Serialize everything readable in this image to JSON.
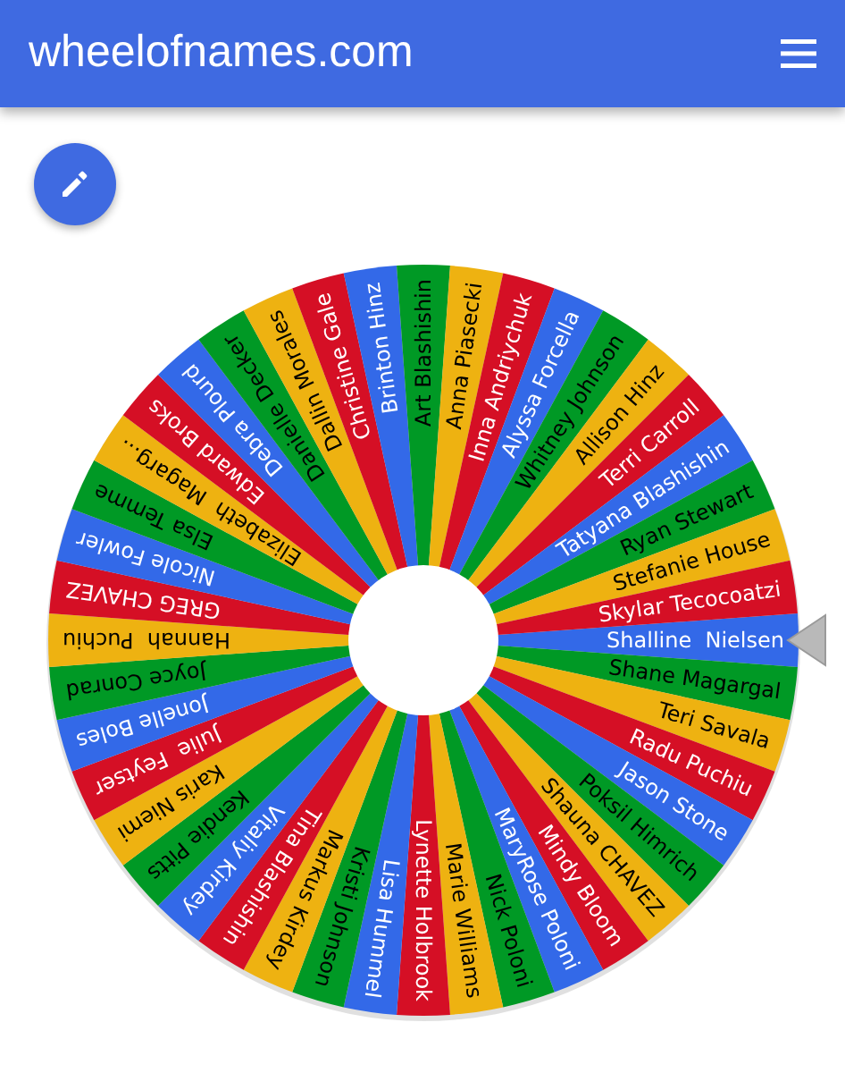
{
  "header": {
    "title": "wheelofnames.com"
  },
  "wheel": {
    "entries": [
      {
        "name": "Shalline  Nielsen"
      },
      {
        "name": "Shane Magargal"
      },
      {
        "name": "Teri Savala"
      },
      {
        "name": "Radu Puchiu"
      },
      {
        "name": "Jason Stone"
      },
      {
        "name": "Poksil Himrich"
      },
      {
        "name": "Shauna CHAVEZ"
      },
      {
        "name": "Mindy Bloom"
      },
      {
        "name": "MaryRose Poloni"
      },
      {
        "name": "Nick Poloni"
      },
      {
        "name": "Marie Williams"
      },
      {
        "name": "Lynette Holbrook"
      },
      {
        "name": "Lisa Hummel"
      },
      {
        "name": "Kristi Johnson"
      },
      {
        "name": "Markus Kirdey"
      },
      {
        "name": "Tina Blashishin"
      },
      {
        "name": "Vitaliy Kirdey"
      },
      {
        "name": "Kendie Pitts"
      },
      {
        "name": "Karis Niemi"
      },
      {
        "name": "Julie  Feytser"
      },
      {
        "name": "Jonelle Boles"
      },
      {
        "name": "Joyce Conrad"
      },
      {
        "name": "Hannah  Puchiu"
      },
      {
        "name": "GREG CHAVEZ"
      },
      {
        "name": "Nicole Fowler"
      },
      {
        "name": "Elsa Temme"
      },
      {
        "name": "Elizabeth  Magarg..."
      },
      {
        "name": "Edward Broks"
      },
      {
        "name": "Debra Plourd"
      },
      {
        "name": "Danielle Decker"
      },
      {
        "name": "Dallin Morales"
      },
      {
        "name": "Christine Gale"
      },
      {
        "name": "Brinton Hinz"
      },
      {
        "name": "Art Blashishin"
      },
      {
        "name": "Anna Piasecki"
      },
      {
        "name": "Inna Andriychuk"
      },
      {
        "name": "Alyssa Forcella"
      },
      {
        "name": "Whitney Johnson"
      },
      {
        "name": "Allison Hinz"
      },
      {
        "name": "Terri Carroll"
      },
      {
        "name": "Tatyana Blashishin"
      },
      {
        "name": "Ryan Stewart"
      },
      {
        "name": "Stefanie House"
      },
      {
        "name": "Skylar Tecocoatzi"
      }
    ]
  }
}
